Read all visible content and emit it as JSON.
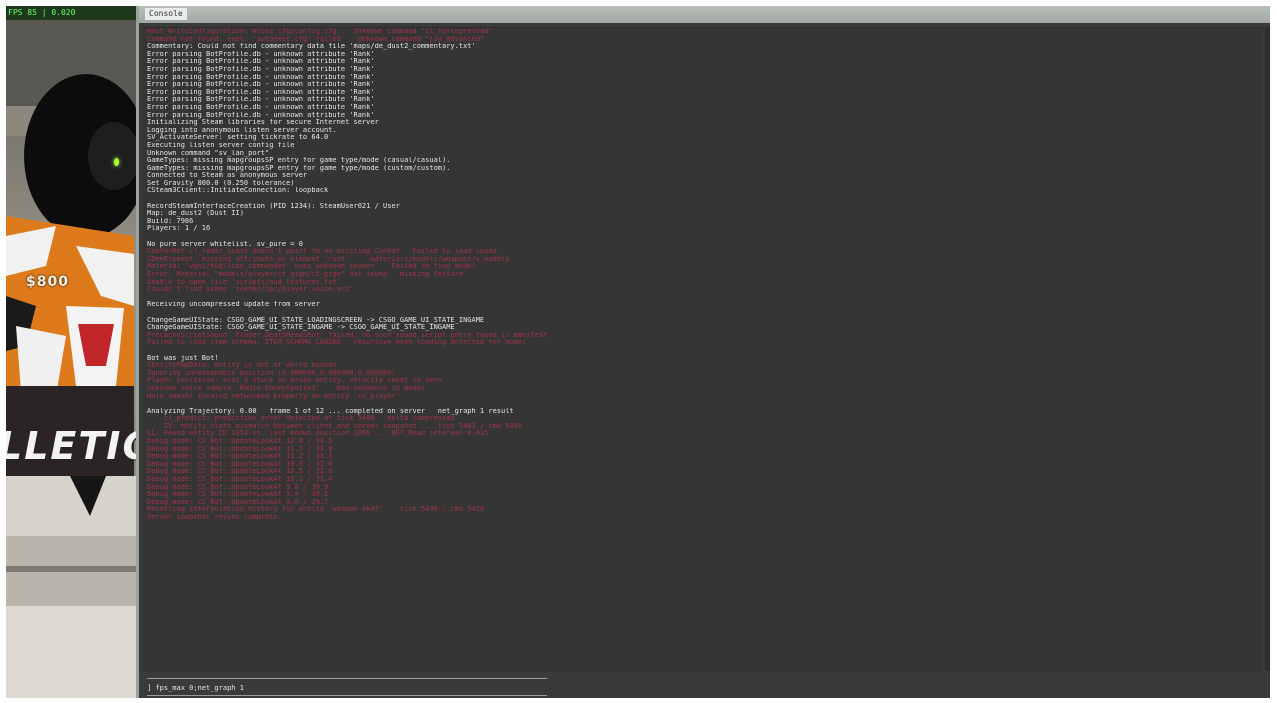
{
  "game": {
    "hud_top": "FPS 85 | 0.020",
    "money": "$800",
    "wall_text": "LLETIC"
  },
  "console": {
    "title": "Console",
    "lines": [
      {
        "style": "r",
        "text": "Host_WriteConfiguration: Wrote cfg/config.cfg    Unknown command \"cl_forcepreload\""
      },
      {
        "style": "r",
        "text": "Command not found: exec: 'autoexec.cfg' failed    Unknown command \"joy_advanced\""
      },
      {
        "style": "w",
        "text": "Commentary: Could not find commentary data file 'maps/de_dust2_commentary.txt'"
      },
      {
        "style": "w",
        "text": "Error parsing BotProfile.db - unknown attribute 'Rank'"
      },
      {
        "style": "w",
        "text": "Error parsing BotProfile.db - unknown attribute 'Rank'"
      },
      {
        "style": "w",
        "text": "Error parsing BotProfile.db - unknown attribute 'Rank'"
      },
      {
        "style": "w",
        "text": "Error parsing BotProfile.db - unknown attribute 'Rank'"
      },
      {
        "style": "w",
        "text": "Error parsing BotProfile.db - unknown attribute 'Rank'"
      },
      {
        "style": "w",
        "text": "Error parsing BotProfile.db - unknown attribute 'Rank'"
      },
      {
        "style": "w",
        "text": "Error parsing BotProfile.db - unknown attribute 'Rank'"
      },
      {
        "style": "w",
        "text": "Error parsing BotProfile.db - unknown attribute 'Rank'"
      },
      {
        "style": "w",
        "text": "Error parsing BotProfile.db - unknown attribute 'Rank'"
      },
      {
        "style": "w",
        "text": "Initializing Steam libraries for secure Internet server"
      },
      {
        "style": "w",
        "text": "Logging into anonymous listen server account."
      },
      {
        "style": "w",
        "text": "SV_ActivateServer: setting tickrate to 64.0"
      },
      {
        "style": "w",
        "text": "Executing listen server config file"
      },
      {
        "style": "w",
        "text": "Unknown command \"sv_lan_port\""
      },
      {
        "style": "w",
        "text": "GameTypes: missing mapgroupsSP entry for game type/mode (casual/casual)."
      },
      {
        "style": "w",
        "text": "GameTypes: missing mapgroupsSP entry for game type/mode (custom/custom)."
      },
      {
        "style": "w",
        "text": "Connected to Steam as anonymous server"
      },
      {
        "style": "w",
        "text": "Set Gravity 800.0 (0.250 tolerance)"
      },
      {
        "style": "w",
        "text": "CSteam3Client::InitiateConnection: loopback"
      },
      {
        "style": "blank",
        "text": "."
      },
      {
        "style": "w",
        "text": "RecordSteamInterfaceCreation (PID 1234): SteamUser021 / User"
      },
      {
        "style": "w",
        "text": "Map: de_dust2 (Dust II)"
      },
      {
        "style": "w",
        "text": "Build: 7986"
      },
      {
        "style": "w",
        "text": "Players: 1 / 16"
      },
      {
        "style": "blank",
        "text": "."
      },
      {
        "style": "w",
        "text": "No pure server whitelist. sv_pure = 0"
      },
      {
        "style": "r",
        "text": "ConVarRef cl_radar_scale doesn't point to an existing ConVar   Failed to load sound"
      },
      {
        "style": "r",
        "text": "CDmeElement: missing attribute on element 'root'     materials/models/weapons/v_models"
      },
      {
        "style": "r",
        "text": "Material 'vgui/hud/icon_commander' uses unknown shader    Failed to find model"
      },
      {
        "style": "r",
        "text": "Error: Material \"models/player/ct_gign/ct_gign\" not found   missing texture"
      },
      {
        "style": "r",
        "text": "Unable to open file 'scripts/hud_textures.txt'"
      },
      {
        "style": "r",
        "text": "Couldn't find scene 'scenes/npc/player_voice.vcd'"
      },
      {
        "style": "blank",
        "text": "."
      },
      {
        "style": "w",
        "text": "Receiving uncompressed update from server"
      },
      {
        "style": "blank",
        "text": "."
      },
      {
        "style": "w",
        "text": "ChangeGameUIState: CSGO_GAME_UI_STATE_LOADINGSCREEN -> CSGO_GAME_UI_STATE_INGAME"
      },
      {
        "style": "w",
        "text": "ChangeGameUIState: CSGO_GAME_UI_STATE_INGAME -> CSGO_GAME_UI_STATE_INGAME"
      },
      {
        "style": "r",
        "text": "PrecacheScriptSound 'Player.DeathHeadShot' failed, no such sound script entry found in manifest"
      },
      {
        "style": "r",
        "text": "Failed to load item schema: ITEM_SCHEMA_LOADED   recursive mesh loading detected for model"
      },
      {
        "style": "blank",
        "text": "."
      },
      {
        "style": "w",
        "text": "Bot was just Bot!"
      },
      {
        "style": "r",
        "text": "CEntityMapData: entity is out of world bounds"
      },
      {
        "style": "r",
        "text": "Ignoring unreasonable position (0.000000,0.000000,0.000000)"
      },
      {
        "style": "r",
        "text": "Player collision: slot 3 stuck on brush entity, velocity reset to zero"
      },
      {
        "style": "r",
        "text": "Unknown voice sample 'Radio.EnemySpotted'    Bad sequence in model"
      },
      {
        "style": "r",
        "text": "Hulk smash! Invalid networked property on entity 'cs_player'"
      },
      {
        "style": "blank",
        "text": "."
      },
      {
        "style": "w",
        "text": "Analyzing Trajectory: 0.00   frame 1 of 12 ... completed on server   net_graph 1 result"
      },
      {
        "style": "r",
        "text": "    cl_predict: prediction error detected at tick 5400   delta compressed"
      },
      {
        "style": "r",
        "text": "    SV: entity state mismatch between client and server snapshot ... tick 5401 / cmd 5399"
      },
      {
        "style": "r",
        "text": "CL: Found entity ID 1054 vs. last known position 1050 ... NET_Read interval 0.015"
      },
      {
        "style": "r",
        "text": "Debug mode: CS_Bot::UpdateLookAt 12.0 / 34.5"
      },
      {
        "style": "r",
        "text": "Debug mode: CS_Bot::UpdateLookAt 11.7 / 33.9"
      },
      {
        "style": "r",
        "text": "Debug mode: CS_Bot::UpdateLookAt 11.2 / 33.1"
      },
      {
        "style": "r",
        "text": "Debug mode: CS_Bot::UpdateLookAt 10.9 / 32.6"
      },
      {
        "style": "r",
        "text": "Debug mode: CS_Bot::UpdateLookAt 10.5 / 32.0"
      },
      {
        "style": "r",
        "text": "Debug mode: CS_Bot::UpdateLookAt 10.1 / 31.4"
      },
      {
        "style": "r",
        "text": "Debug mode: CS_Bot::UpdateLookAt 9.8 / 30.9"
      },
      {
        "style": "r",
        "text": "Debug mode: CS_Bot::UpdateLookAt 9.4 / 30.2"
      },
      {
        "style": "r",
        "text": "Debug mode: CS_Bot::UpdateLookAt 9.0 / 29.7"
      },
      {
        "style": "r",
        "text": "Resetting interpolation history for entity 'weapon_ak47'    tick 5430 / cmd 5428"
      },
      {
        "style": "r",
        "text": "Server snapshot resync complete."
      },
      {
        "style": "blank",
        "text": "."
      }
    ],
    "input_text": "] fps_max 0;net_graph 1"
  }
}
